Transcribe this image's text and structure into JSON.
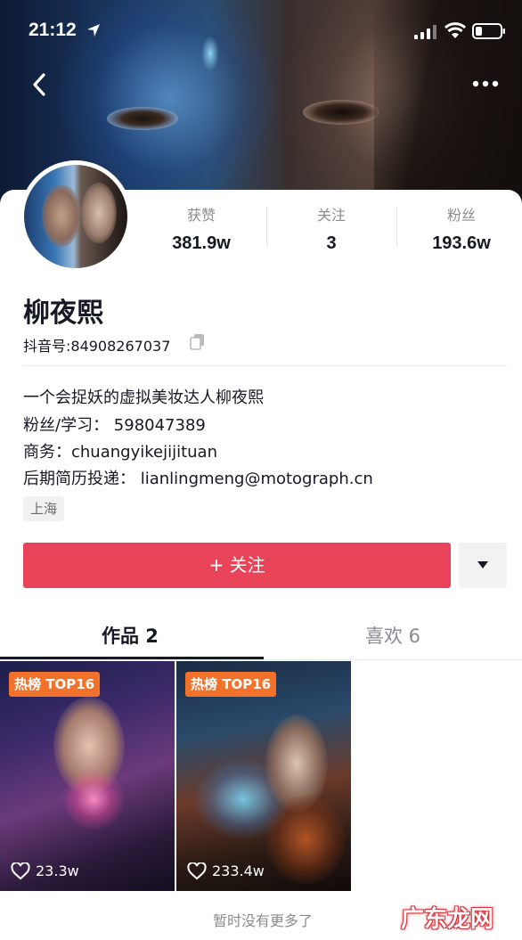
{
  "status_bar": {
    "time": "21:12",
    "icons": [
      "location-arrow-icon",
      "signal-icon",
      "wifi-icon",
      "battery-icon"
    ]
  },
  "nav": {
    "back_icon": "chevron-left-icon",
    "more_icon": "more-dots-icon"
  },
  "profile": {
    "stats": [
      {
        "label": "获赞",
        "value": "381.9w"
      },
      {
        "label": "关注",
        "value": "3"
      },
      {
        "label": "粉丝",
        "value": "193.6w"
      }
    ],
    "name": "柳夜熙",
    "douyin_id": "抖音号:84908267037",
    "bio_lines": [
      "一个会捉妖的虚拟美妆达人柳夜熙",
      "粉丝/学习：  598047389",
      "商务：chuangyikejijituan",
      "后期简历投递：  lianlingmeng@motograph.cn"
    ],
    "location_tag": "上海"
  },
  "actions": {
    "follow_label": "+ 关注",
    "dropdown_icon": "triangle-down-icon"
  },
  "tabs": [
    {
      "label": "作品 2",
      "active": true
    },
    {
      "label": "喜欢 6",
      "active": false
    }
  ],
  "videos": [
    {
      "badge": "热榜 TOP16",
      "likes": "23.3w"
    },
    {
      "badge": "热榜 TOP16",
      "likes": "233.4w"
    }
  ],
  "footer": {
    "no_more": "暂时没有更多了",
    "watermark": "广东龙网"
  },
  "colors": {
    "follow_button": "#e94359",
    "hot_badge": "#f2722c",
    "text_primary": "#161823",
    "text_secondary": "#8a8b91"
  }
}
